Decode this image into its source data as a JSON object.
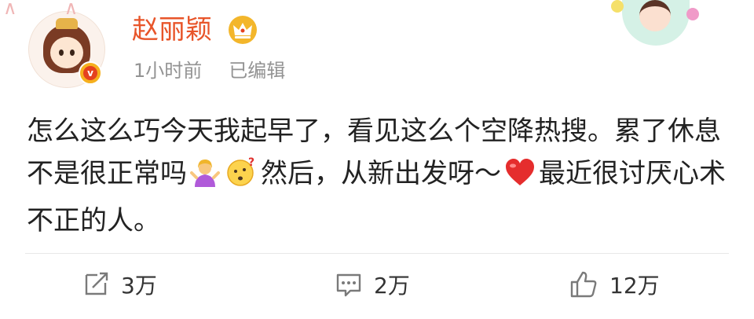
{
  "post": {
    "author": {
      "name": "赵丽颖",
      "badge": "v",
      "avatar_icon": "avatar-cartoon-girl",
      "member_icon": "crown-icon"
    },
    "meta": {
      "time": "1小时前",
      "edited": "已编辑"
    },
    "content": {
      "part1": "怎么这么巧今天我起早了，看见这么个空降热搜。累了休息不是很正常吗",
      "part2": "然后，从新出发呀～",
      "part3": "最近很讨厌心术不正的人。",
      "emojis": [
        "person-shrugging-emoji",
        "thinking-face-emoji",
        "red-heart-emoji"
      ]
    },
    "actions": {
      "repost": "3万",
      "comment": "2万",
      "like": "12万"
    },
    "colors": {
      "username": "#e8552a",
      "meta": "#939393",
      "text": "#222222",
      "icon": "#7a7a7a"
    }
  }
}
